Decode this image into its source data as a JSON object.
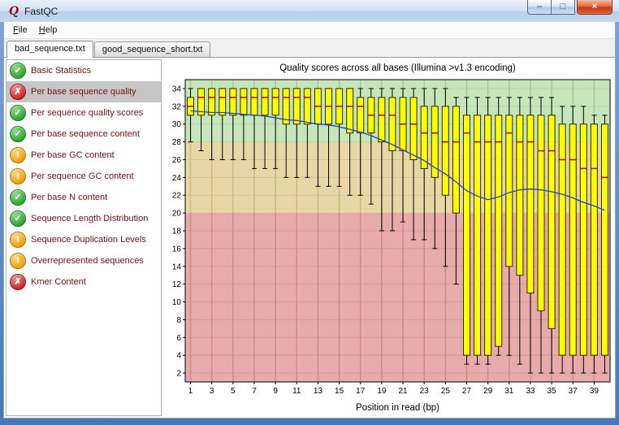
{
  "window": {
    "title": "FastQC",
    "icon_glyph": "Q",
    "controls": [
      {
        "name": "minimize",
        "glyph": "–"
      },
      {
        "name": "maximize",
        "glyph": "□"
      },
      {
        "name": "close",
        "glyph": "×"
      }
    ]
  },
  "menu": {
    "items": [
      {
        "label": "File"
      },
      {
        "label": "Help"
      }
    ]
  },
  "tabs": [
    {
      "label": "bad_sequence.txt",
      "active": true
    },
    {
      "label": "good_sequence_short.txt",
      "active": false
    }
  ],
  "status_glyphs": {
    "pass": "✓",
    "warn": "!",
    "fail": "✗"
  },
  "sidebar": {
    "items": [
      {
        "label": "Basic Statistics",
        "status": "pass",
        "selected": false
      },
      {
        "label": "Per base sequence quality",
        "status": "fail",
        "selected": true
      },
      {
        "label": "Per sequence quality scores",
        "status": "pass",
        "selected": false
      },
      {
        "label": "Per base sequence content",
        "status": "pass",
        "selected": false
      },
      {
        "label": "Per base GC content",
        "status": "warn",
        "selected": false
      },
      {
        "label": "Per sequence GC content",
        "status": "warn",
        "selected": false
      },
      {
        "label": "Per base N content",
        "status": "pass",
        "selected": false
      },
      {
        "label": "Sequence Length Distribution",
        "status": "pass",
        "selected": false
      },
      {
        "label": "Sequence Duplication Levels",
        "status": "warn",
        "selected": false
      },
      {
        "label": "Overrepresented sequences",
        "status": "warn",
        "selected": false
      },
      {
        "label": "Kmer Content",
        "status": "fail",
        "selected": false
      }
    ]
  },
  "chart_data": {
    "type": "boxplot",
    "title": "Quality scores across all bases (Illumina >v1.3 encoding)",
    "xlabel": "Position in read (bp)",
    "ylim": [
      1,
      35
    ],
    "yticks": [
      2,
      4,
      6,
      8,
      10,
      12,
      14,
      16,
      18,
      20,
      22,
      24,
      26,
      28,
      30,
      32,
      34
    ],
    "x": [
      1,
      2,
      3,
      4,
      5,
      6,
      7,
      8,
      9,
      10,
      11,
      12,
      13,
      14,
      15,
      16,
      17,
      18,
      19,
      20,
      21,
      22,
      23,
      24,
      25,
      26,
      27,
      28,
      29,
      30,
      31,
      32,
      33,
      34,
      35,
      36,
      37,
      38,
      39,
      40
    ],
    "x_ticks": [
      1,
      3,
      5,
      7,
      9,
      11,
      13,
      15,
      17,
      19,
      21,
      23,
      25,
      27,
      29,
      31,
      33,
      35,
      37,
      39
    ],
    "bands": [
      {
        "name": "good",
        "from": 28,
        "to": 35,
        "color": "#c7e5bb",
        "grid": "#9cc894"
      },
      {
        "name": "medium",
        "from": 20,
        "to": 28,
        "color": "#e7d7a7",
        "grid": "#cdb27a"
      },
      {
        "name": "poor",
        "from": 1,
        "to": 20,
        "color": "#e7abab",
        "grid": "#cd8484"
      }
    ],
    "box_color": "#ffff00",
    "median_color": "#b00000",
    "mean_color": "#2743b8",
    "boxes": [
      [
        28,
        31,
        32,
        33,
        34
      ],
      [
        27,
        31,
        33,
        34,
        34
      ],
      [
        26,
        31,
        33,
        34,
        34
      ],
      [
        26,
        31,
        33,
        34,
        34
      ],
      [
        26,
        31,
        33,
        34,
        34
      ],
      [
        26,
        31,
        33,
        34,
        34
      ],
      [
        25,
        31,
        33,
        34,
        34
      ],
      [
        25,
        31,
        33,
        34,
        34
      ],
      [
        25,
        31,
        33,
        34,
        34
      ],
      [
        24,
        30,
        33,
        34,
        34
      ],
      [
        24,
        30,
        33,
        34,
        34
      ],
      [
        24,
        30,
        33,
        34,
        34
      ],
      [
        23,
        30,
        32,
        34,
        34
      ],
      [
        23,
        30,
        32,
        34,
        34
      ],
      [
        23,
        30,
        32,
        34,
        34
      ],
      [
        22,
        29,
        32,
        34,
        34
      ],
      [
        22,
        29,
        32,
        33,
        34
      ],
      [
        21,
        29,
        31,
        33,
        34
      ],
      [
        18,
        28,
        31,
        33,
        34
      ],
      [
        18,
        27,
        31,
        33,
        34
      ],
      [
        19,
        27,
        30,
        33,
        34
      ],
      [
        17,
        26,
        30,
        33,
        34
      ],
      [
        17,
        25,
        29,
        32,
        34
      ],
      [
        16,
        24,
        29,
        32,
        34
      ],
      [
        14,
        22,
        28,
        32,
        34
      ],
      [
        12,
        20,
        28,
        32,
        33
      ],
      [
        3,
        4,
        29,
        31,
        33
      ],
      [
        3,
        4,
        28,
        31,
        33
      ],
      [
        3,
        4,
        28,
        31,
        33
      ],
      [
        4,
        5,
        28,
        31,
        33
      ],
      [
        4,
        14,
        29,
        31,
        33
      ],
      [
        3,
        13,
        28,
        31,
        33
      ],
      [
        2,
        11,
        28,
        31,
        33
      ],
      [
        2,
        9,
        27,
        31,
        33
      ],
      [
        2,
        7,
        27,
        31,
        33
      ],
      [
        2,
        4,
        26,
        30,
        32
      ],
      [
        2,
        4,
        26,
        30,
        32
      ],
      [
        2,
        4,
        25,
        30,
        32
      ],
      [
        2,
        4,
        25,
        30,
        31
      ],
      [
        2,
        4,
        24,
        30,
        31
      ]
    ],
    "mean": [
      31.5,
      31.4,
      31.3,
      31.3,
      31.2,
      31.1,
      31.0,
      30.9,
      30.7,
      30.5,
      30.4,
      30.2,
      30.0,
      29.9,
      29.7,
      29.4,
      29.1,
      28.7,
      28.2,
      27.7,
      27.1,
      26.5,
      25.9,
      25.1,
      24.4,
      23.5,
      22.5,
      21.9,
      21.5,
      21.8,
      22.3,
      22.6,
      22.7,
      22.6,
      22.4,
      22.1,
      21.7,
      21.2,
      20.8,
      20.3
    ]
  }
}
